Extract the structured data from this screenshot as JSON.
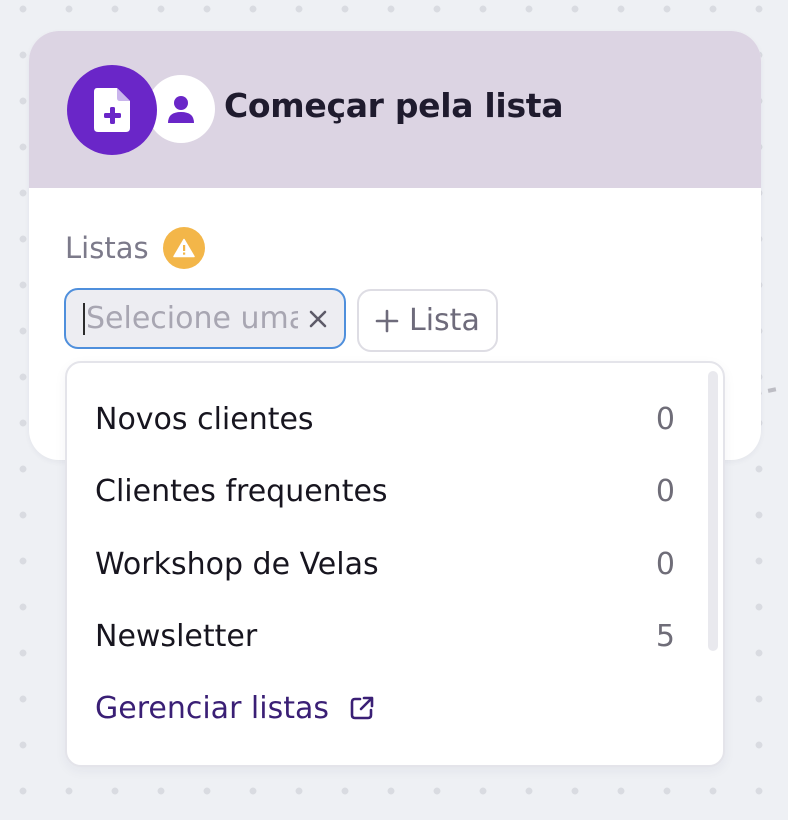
{
  "card": {
    "title": "Começar pela lista",
    "header_icon": "file-add-icon",
    "secondary_icon": "user-icon"
  },
  "field": {
    "label": "Listas",
    "warning_icon": "warning-icon"
  },
  "select": {
    "placeholder": "Selecione uma",
    "clear_icon": "close-icon"
  },
  "add_button": {
    "label": "Lista",
    "icon": "plus-icon"
  },
  "dropdown": {
    "options": [
      {
        "label": "Novos clientes",
        "count": "0"
      },
      {
        "label": "Clientes frequentes",
        "count": "0"
      },
      {
        "label": "Workshop de Velas",
        "count": "0"
      },
      {
        "label": "Newsletter",
        "count": "5"
      }
    ],
    "manage_link": "Gerenciar listas",
    "manage_icon": "external-link-icon"
  },
  "colors": {
    "accent": "#6a26c8",
    "header_bg": "#dcd4e3",
    "focus_border": "#4f8fdc",
    "warning": "#f3b649",
    "link": "#3a1f75"
  }
}
